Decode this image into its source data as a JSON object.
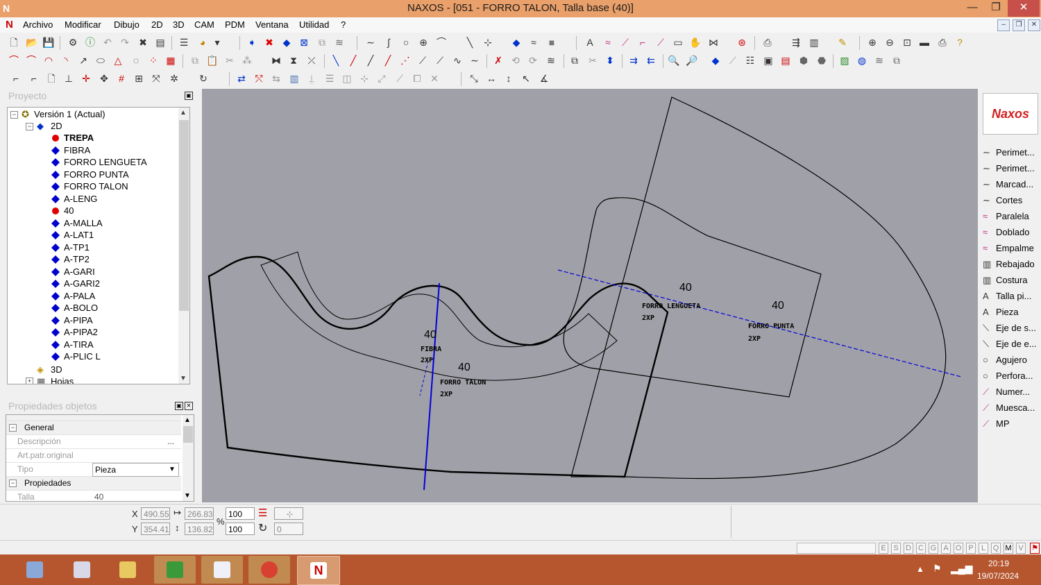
{
  "window": {
    "title": "NAXOS - [051 - FORRO TALON, Talla base (40)]",
    "minimize_glyph": "—",
    "restore_glyph": "❐",
    "close_glyph": "✕"
  },
  "menu": {
    "items": [
      "Archivo",
      "Modificar",
      "Dibujo",
      "2D",
      "3D",
      "CAM",
      "PDM",
      "Ventana",
      "Utilidad",
      "?"
    ]
  },
  "project_panel": {
    "title": "Proyecto",
    "tree": {
      "root": "Versión 1 (Actual)",
      "group_2d": "2D",
      "items": [
        {
          "label": "TREPA",
          "marker": "red-circle",
          "bold": true
        },
        {
          "label": "FIBRA",
          "marker": "blue-diamond"
        },
        {
          "label": "FORRO LENGUETA",
          "marker": "blue-diamond"
        },
        {
          "label": "FORRO PUNTA",
          "marker": "blue-diamond"
        },
        {
          "label": "FORRO TALON",
          "marker": "blue-diamond"
        },
        {
          "label": "A-LENG",
          "marker": "blue-diamond"
        },
        {
          "label": "40",
          "marker": "red-circle"
        },
        {
          "label": "A-MALLA",
          "marker": "blue-diamond"
        },
        {
          "label": "A-LAT1",
          "marker": "blue-diamond"
        },
        {
          "label": "A-TP1",
          "marker": "blue-diamond"
        },
        {
          "label": "A-TP2",
          "marker": "blue-diamond"
        },
        {
          "label": "A-GARI",
          "marker": "blue-diamond"
        },
        {
          "label": "A-GARI2",
          "marker": "blue-diamond"
        },
        {
          "label": "A-PALA",
          "marker": "blue-diamond"
        },
        {
          "label": "A-BOLO",
          "marker": "blue-diamond"
        },
        {
          "label": "A-PIPA",
          "marker": "blue-diamond"
        },
        {
          "label": "A-PIPA2",
          "marker": "blue-diamond"
        },
        {
          "label": "A-TIRA",
          "marker": "blue-diamond"
        },
        {
          "label": "A-PLIC L",
          "marker": "blue-diamond"
        }
      ],
      "group_3d": "3D",
      "group_hojas": "Hojas"
    }
  },
  "properties_panel": {
    "title": "Propiedades objetos",
    "sections": {
      "general": "General",
      "propiedades": "Propiedades"
    },
    "rows": {
      "descripcion": {
        "label": "Descripción",
        "value": "",
        "button": "..."
      },
      "art_patr": {
        "label": "Art.patr.original",
        "value": ""
      },
      "tipo": {
        "label": "Tipo",
        "value": "Pieza"
      },
      "talla": {
        "label": "Talla",
        "value": "40"
      }
    }
  },
  "canvas": {
    "labels": {
      "fibra_size": "40",
      "fibra_name": "FIBRA",
      "fibra_qty": "2XP",
      "talon_size": "40",
      "talon_name": "FORRO TALON",
      "talon_qty": "2XP",
      "lengueta_size": "40",
      "lengueta_name": "FORRO LENGUETA",
      "lengueta_qty": "2XP",
      "punta_size": "40",
      "punta_name": "FORRO PUNTA",
      "punta_qty": "2XP"
    }
  },
  "palette": {
    "logo": "Naxos",
    "items": [
      {
        "label": "Perimet...",
        "icon": "curve-icon"
      },
      {
        "label": "Perimet...",
        "icon": "curve-icon"
      },
      {
        "label": "Marcad...",
        "icon": "curve-icon"
      },
      {
        "label": "Cortes",
        "icon": "curve-icon"
      },
      {
        "label": "Paralela",
        "icon": "parallel-curve-icon"
      },
      {
        "label": "Doblado",
        "icon": "parallel-curve-icon"
      },
      {
        "label": "Empalme",
        "icon": "parallel-curve-icon"
      },
      {
        "label": "Rebajado",
        "icon": "stitch-icon"
      },
      {
        "label": "Costura",
        "icon": "stitch-icon"
      },
      {
        "label": "Talla pi...",
        "icon": "text-a-icon"
      },
      {
        "label": "Pieza",
        "icon": "text-a-icon"
      },
      {
        "label": "Eje de s...",
        "icon": "axis-line-icon"
      },
      {
        "label": "Eje de e...",
        "icon": "axis-line-icon"
      },
      {
        "label": "Agujero",
        "icon": "circle-icon"
      },
      {
        "label": "Perfora...",
        "icon": "circle-icon"
      },
      {
        "label": "Numer...",
        "icon": "pen-icon"
      },
      {
        "label": "Muesca...",
        "icon": "pen-icon"
      },
      {
        "label": "MP",
        "icon": "pen-icon"
      }
    ]
  },
  "coords": {
    "x_label": "X",
    "y_label": "Y",
    "x": "490.55",
    "y": "354.41",
    "width": "266.83",
    "height": "136.82",
    "percent_label": "%",
    "scale_x": "100",
    "scale_y": "100",
    "angle": "0"
  },
  "status": {
    "keys": [
      "E",
      "S",
      "D",
      "C",
      "G",
      "A",
      "O",
      "P",
      "L",
      "Q",
      "M",
      "V"
    ]
  },
  "taskbar": {
    "time": "20:19",
    "date": "19/07/2024",
    "apps": [
      "calculator",
      "file-manager",
      "folder",
      "naxos-green",
      "info-app",
      "chrome",
      "naxos"
    ]
  },
  "colors": {
    "titlebar": "#e9a06a",
    "taskbar": "#b5562e",
    "canvas": "#a0a0a8",
    "axis_blue": "#0000dd"
  }
}
